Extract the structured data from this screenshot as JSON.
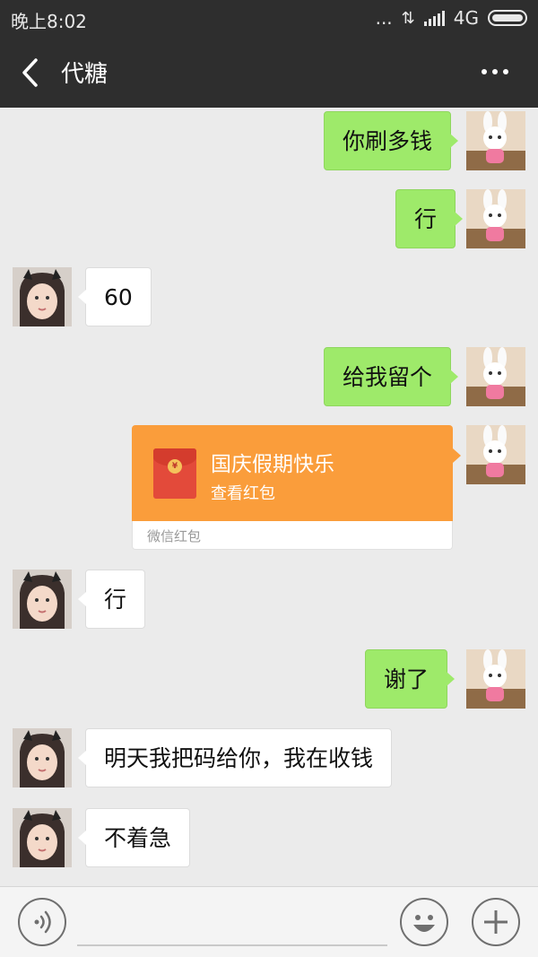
{
  "status_bar": {
    "time": "晚上8:02",
    "dots": "...",
    "network": "4G"
  },
  "nav": {
    "title": "代糖"
  },
  "messages": [
    {
      "side": "out",
      "text": "你刷多钱"
    },
    {
      "side": "out",
      "text": "行"
    },
    {
      "side": "in",
      "text": "60"
    },
    {
      "side": "out",
      "text": "给我留个"
    },
    {
      "side": "out",
      "type": "red_packet",
      "title": "国庆假期快乐",
      "subtitle": "查看红包",
      "source": "微信红包"
    },
    {
      "side": "in",
      "text": "行"
    },
    {
      "side": "out",
      "text": "谢了"
    },
    {
      "side": "in",
      "text": "明天我把码给你，我在收钱"
    },
    {
      "side": "in",
      "text": "不着急"
    }
  ],
  "colors": {
    "header_bg": "#2e2e2e",
    "chat_bg": "#ebebeb",
    "outgoing_bubble": "#9eea6a",
    "incoming_bubble": "#ffffff",
    "red_packet": "#fa9d3b"
  },
  "icons": {
    "back": "chevron-left-icon",
    "more": "more-dots-icon",
    "voice": "voice-input-icon",
    "emoji": "emoji-icon",
    "plus": "plus-icon"
  }
}
